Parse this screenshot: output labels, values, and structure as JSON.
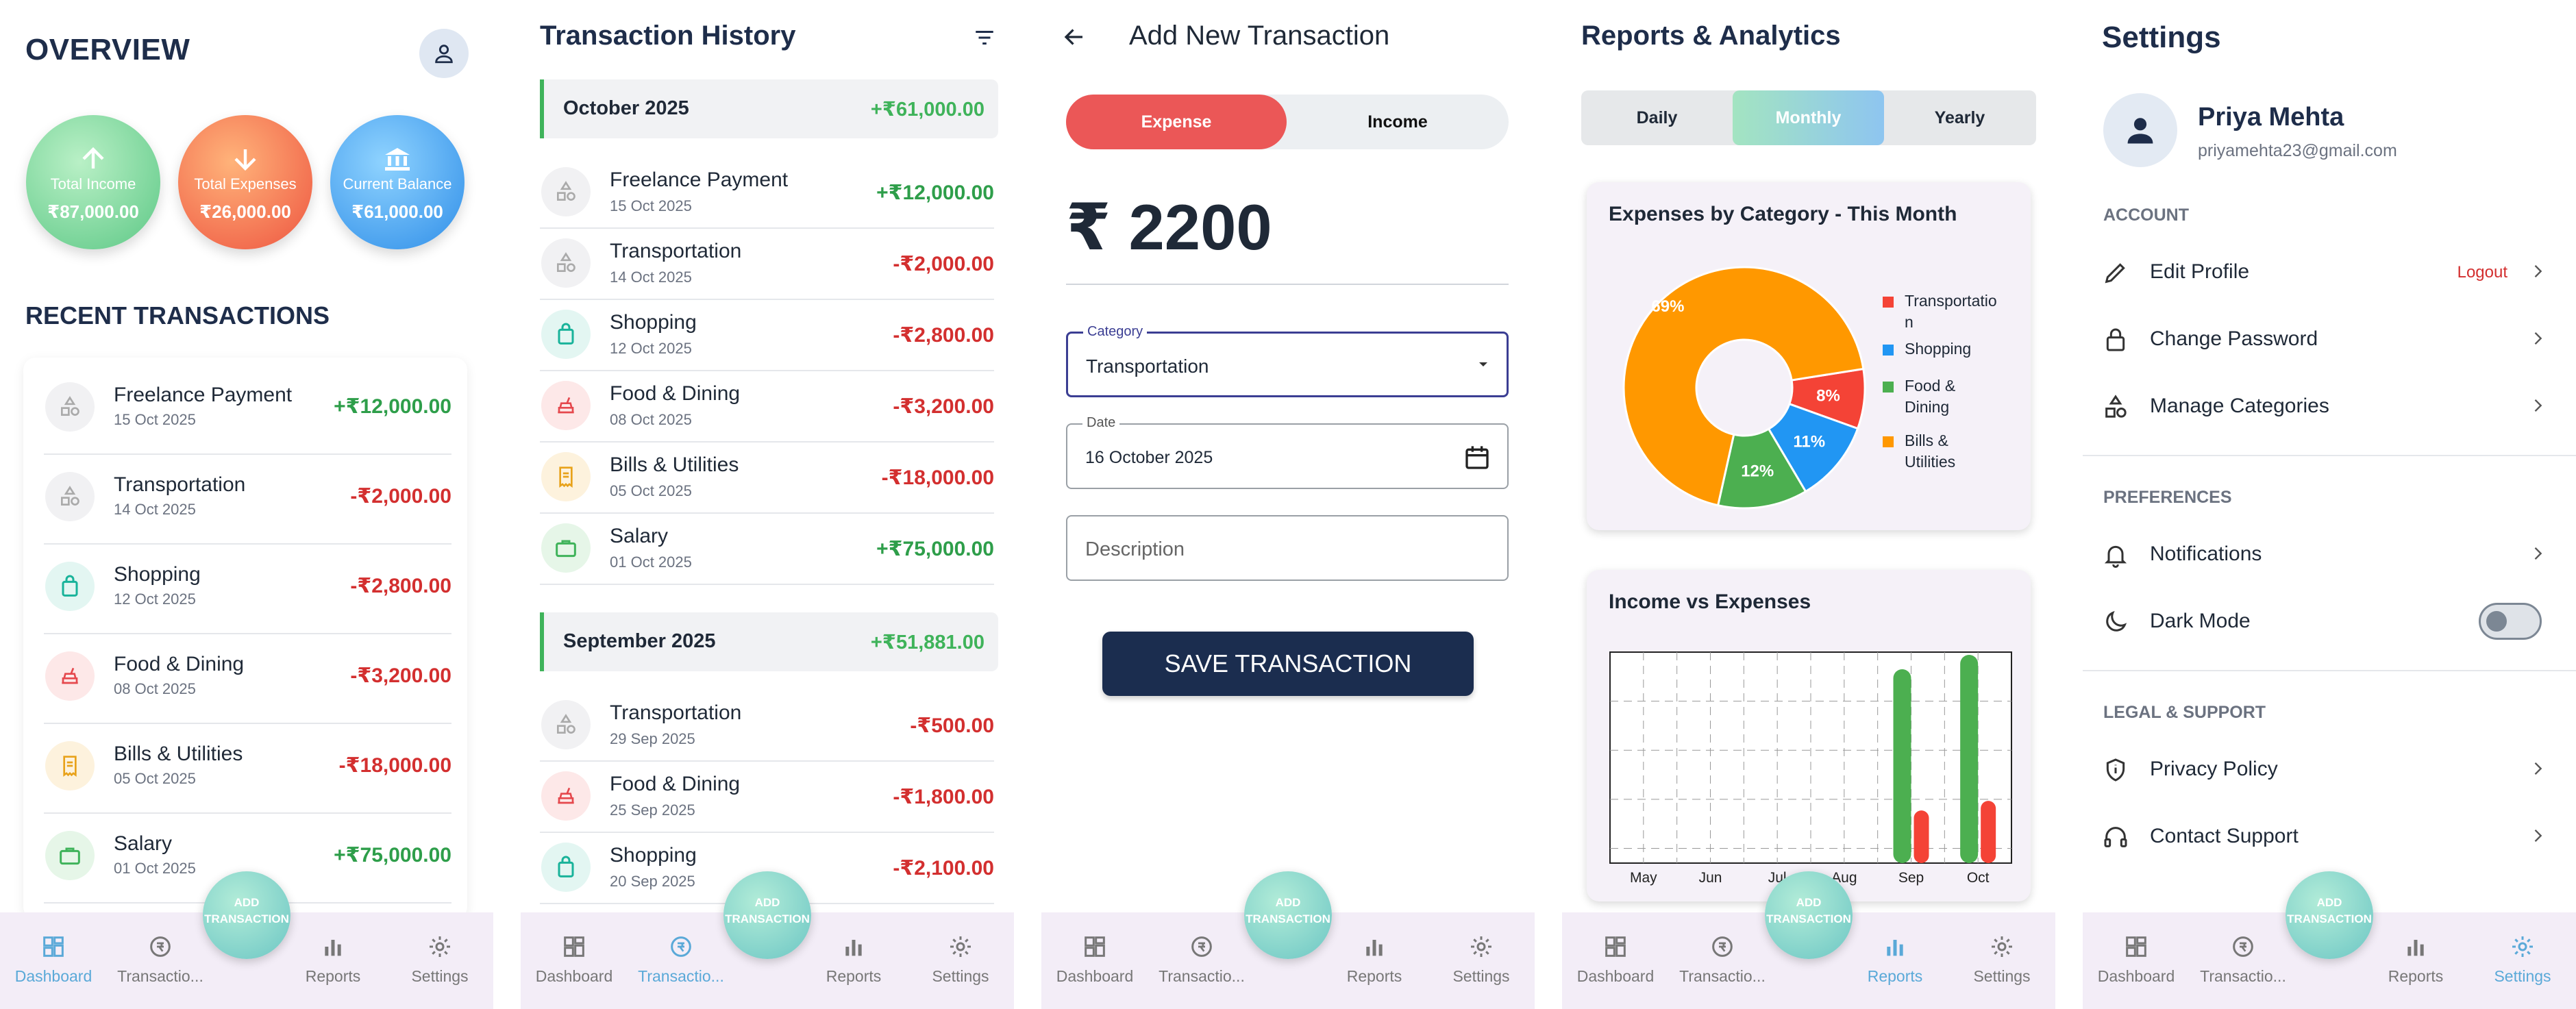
{
  "nav": {
    "items": [
      {
        "label": "Dashboard",
        "icon": "dashboard-icon"
      },
      {
        "label": "Transactio...",
        "icon": "transactions-icon"
      },
      {
        "label": "Reports",
        "icon": "reports-icon"
      },
      {
        "label": "Settings",
        "icon": "settings-icon"
      }
    ],
    "fab_line1": "ADD",
    "fab_line2": "TRANSACTION"
  },
  "overview": {
    "title": "OVERVIEW",
    "total_income_label": "Total Income",
    "total_income_value": "₹87,000.00",
    "total_expenses_label": "Total Expenses",
    "total_expenses_value": "₹26,000.00",
    "balance_label": "Current Balance",
    "balance_value": "₹61,000.00",
    "recent_title": "RECENT TRANSACTIONS",
    "recent": [
      {
        "name": "Freelance Payment",
        "date": "15 Oct 2025",
        "amount": "+₹12,000.00",
        "type": "pos",
        "icon": "category-icon"
      },
      {
        "name": "Transportation",
        "date": "14 Oct 2025",
        "amount": "-₹2,000.00",
        "type": "neg",
        "icon": "category-icon"
      },
      {
        "name": "Shopping",
        "date": "12 Oct 2025",
        "amount": "-₹2,800.00",
        "type": "neg",
        "icon": "shopping-bag-icon"
      },
      {
        "name": "Food & Dining",
        "date": "08 Oct 2025",
        "amount": "-₹3,200.00",
        "type": "neg",
        "icon": "food-icon"
      },
      {
        "name": "Bills & Utilities",
        "date": "05 Oct 2025",
        "amount": "-₹18,000.00",
        "type": "neg",
        "icon": "receipt-icon"
      },
      {
        "name": "Salary",
        "date": "01 Oct 2025",
        "amount": "+₹75,000.00",
        "type": "pos",
        "icon": "briefcase-icon"
      }
    ]
  },
  "history": {
    "title": "Transaction History",
    "months": [
      {
        "name": "October 2025",
        "total": "+₹61,000.00",
        "items": [
          {
            "name": "Freelance Payment",
            "date": "15 Oct 2025",
            "amount": "+₹12,000.00",
            "type": "pos"
          },
          {
            "name": "Transportation",
            "date": "14 Oct 2025",
            "amount": "-₹2,000.00",
            "type": "neg"
          },
          {
            "name": "Shopping",
            "date": "12 Oct 2025",
            "amount": "-₹2,800.00",
            "type": "neg"
          },
          {
            "name": "Food & Dining",
            "date": "08 Oct 2025",
            "amount": "-₹3,200.00",
            "type": "neg"
          },
          {
            "name": "Bills & Utilities",
            "date": "05 Oct 2025",
            "amount": "-₹18,000.00",
            "type": "neg"
          },
          {
            "name": "Salary",
            "date": "01 Oct 2025",
            "amount": "+₹75,000.00",
            "type": "pos"
          }
        ]
      },
      {
        "name": "September 2025",
        "total": "+₹51,881.00",
        "items": [
          {
            "name": "Transportation",
            "date": "29 Sep 2025",
            "amount": "-₹500.00",
            "type": "neg"
          },
          {
            "name": "Food & Dining",
            "date": "25 Sep 2025",
            "amount": "-₹1,800.00",
            "type": "neg"
          },
          {
            "name": "Shopping",
            "date": "20 Sep 2025",
            "amount": "-₹2,100.00",
            "type": "neg"
          }
        ]
      }
    ]
  },
  "add": {
    "title": "Add New Transaction",
    "expense_label": "Expense",
    "income_label": "Income",
    "amount": "₹ 2200",
    "category_label": "Category",
    "category_value": "Transportation",
    "date_label": "Date",
    "date_value": "16 October 2025",
    "description_placeholder": "Description",
    "save_label": "SAVE TRANSACTION"
  },
  "reports": {
    "title": "Reports & Analytics",
    "periods": [
      "Daily",
      "Monthly",
      "Yearly"
    ],
    "selected_period": "Monthly",
    "pie_title": "Expenses by Category - This Month",
    "bar_title": "Income vs Expenses"
  },
  "chart_data": [
    {
      "type": "pie",
      "title": "Expenses by Category - This Month",
      "categories": [
        "Transportation",
        "Shopping",
        "Food & Dining",
        "Bills & Utilities"
      ],
      "legend_labels": [
        "Transportatio\nn",
        "Shopping",
        "Food &\nDining",
        "Bills &\nUtilities"
      ],
      "values": [
        8,
        11,
        12,
        69
      ],
      "data_labels": [
        "8%",
        "11%",
        "12%",
        "69%"
      ],
      "colors": [
        "#f44336",
        "#2196f3",
        "#4caf50",
        "#ff9800"
      ],
      "donut": true,
      "legend": "right"
    },
    {
      "type": "bar",
      "title": "Income vs Expenses",
      "categories": [
        "May",
        "Jun",
        "Jul",
        "Aug",
        "Sep",
        "Oct"
      ],
      "series": [
        {
          "values": [
            0,
            0,
            0,
            0,
            81000,
            87000
          ],
          "color": "#4caf50"
        },
        {
          "values": [
            0,
            0,
            0,
            0,
            22000,
            26000
          ],
          "color": "#f44336"
        }
      ],
      "ylim": [
        0,
        87000
      ],
      "grid": true
    }
  ],
  "settings": {
    "title": "Settings",
    "user_name": "Priya Mehta",
    "user_email": "priyamehta23@gmail.com",
    "account_header": "ACCOUNT",
    "edit_profile": "Edit Profile",
    "logout": "Logout",
    "change_password": "Change Password",
    "manage_categories": "Manage Categories",
    "preferences_header": "PREFERENCES",
    "notifications": "Notifications",
    "dark_mode": "Dark Mode",
    "legal_header": "LEGAL & SUPPORT",
    "privacy_policy": "Privacy Policy",
    "contact_support": "Contact Support"
  }
}
